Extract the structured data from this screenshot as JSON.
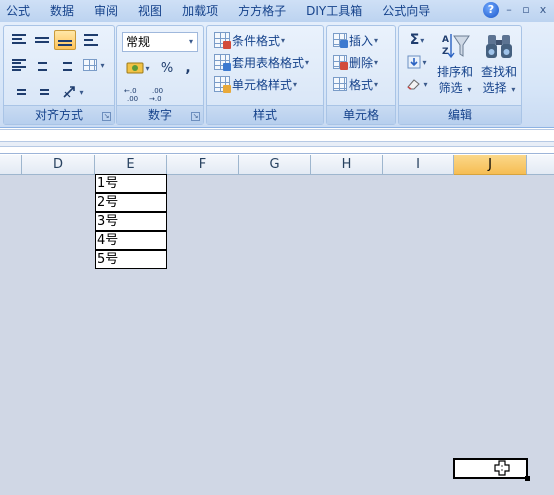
{
  "menu": {
    "tabs": [
      "公式",
      "数据",
      "审阅",
      "视图",
      "加载项",
      "方方格子",
      "DIY工具箱",
      "公式向导"
    ],
    "help_icon": "help-icon",
    "window_controls": [
      "–",
      "▫",
      "x"
    ]
  },
  "ribbon": {
    "alignment": {
      "label": "对齐方式"
    },
    "number": {
      "label": "数字",
      "format_value": "常规",
      "percent": "%",
      "comma": ",",
      "inc_decimal": "←.0 .00",
      "dec_decimal": ".00 →.0"
    },
    "styles": {
      "label": "样式",
      "conditional_format": "条件格式",
      "table_format": "套用表格格式",
      "cell_styles": "单元格样式"
    },
    "cells": {
      "label": "单元格",
      "insert": "插入",
      "delete": "删除",
      "format": "格式"
    },
    "editing": {
      "label": "编辑",
      "sort_filter": [
        "排序和",
        "筛选"
      ],
      "find_select": [
        "查找和",
        "选择"
      ]
    }
  },
  "sheet": {
    "columns": [
      "D",
      "E",
      "F",
      "G",
      "H",
      "I",
      "J"
    ],
    "selected_column": "J",
    "cells": [
      "1号",
      "2号",
      "3号",
      "4号",
      "5号"
    ]
  }
}
